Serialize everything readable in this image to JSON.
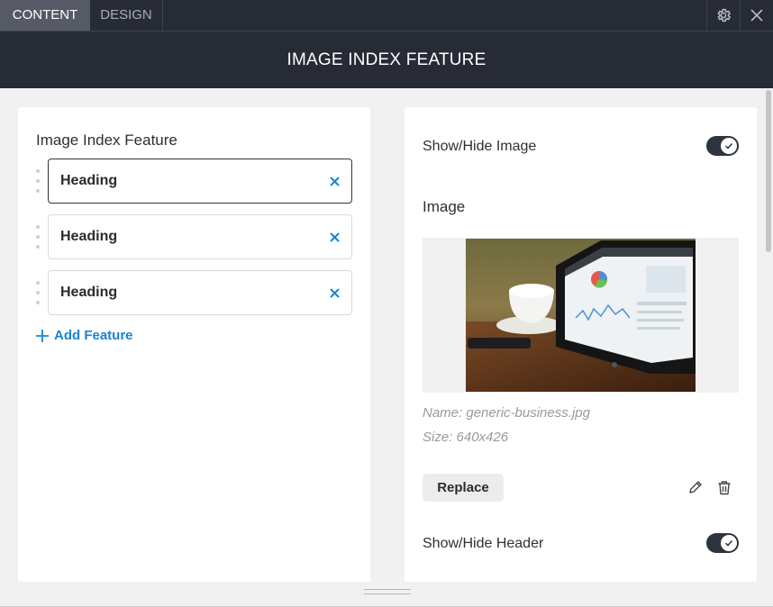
{
  "tabs": [
    {
      "label": "CONTENT",
      "active": true
    },
    {
      "label": "DESIGN",
      "active": false
    }
  ],
  "toolbar": {
    "settings_icon": "gear-icon",
    "close_icon": "close-icon"
  },
  "header": {
    "title": "IMAGE INDEX FEATURE"
  },
  "left_panel": {
    "title": "Image Index Feature",
    "features": [
      {
        "label": "Heading",
        "selected": true
      },
      {
        "label": "Heading",
        "selected": false
      },
      {
        "label": "Heading",
        "selected": false
      }
    ],
    "add_label": "Add Feature"
  },
  "right_panel": {
    "show_image_label": "Show/Hide Image",
    "show_image_on": true,
    "image_section_label": "Image",
    "image_name": "Name: generic-business.jpg",
    "image_size": "Size: 640x426",
    "replace_label": "Replace",
    "show_header_label": "Show/Hide Header",
    "show_header_on": true
  },
  "colors": {
    "accent": "#1a83d2",
    "dark": "#272b36",
    "toggle": "#2e3340"
  }
}
